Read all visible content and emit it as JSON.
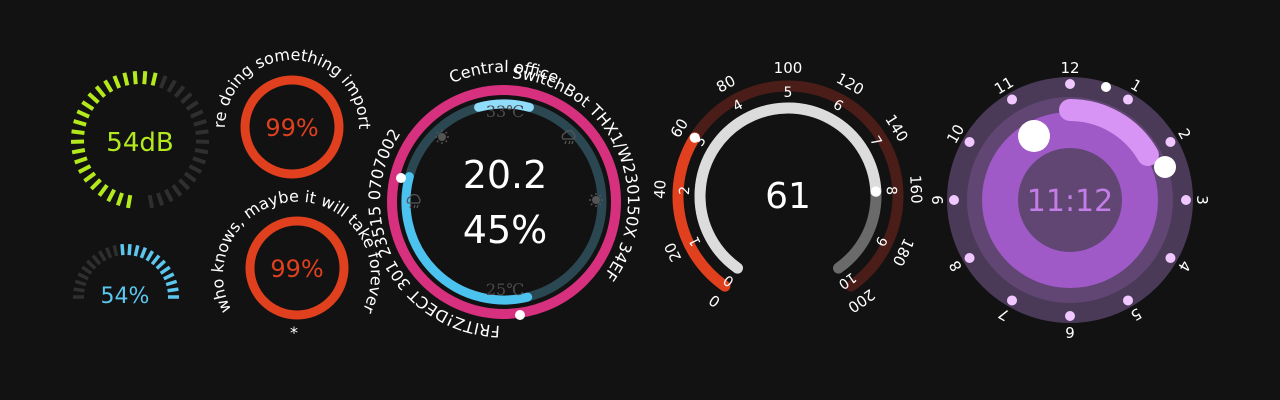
{
  "sound_gauge": {
    "value_text": "54dB",
    "level": 0.54,
    "color": "#b4ea1c"
  },
  "percent_gauge": {
    "value_text": "54%",
    "level": 0.54,
    "color": "#5cc6ee"
  },
  "ring_top": {
    "value_text": "99%",
    "caption": "we're doing something important",
    "level": 0.99,
    "color": "#e0401e"
  },
  "ring_bottom": {
    "value_text": "99%",
    "caption": "who knows, maybe it will take forever",
    "footnote": "*",
    "level": 0.99,
    "color": "#e0401e"
  },
  "thermostat": {
    "title": "Central office",
    "right_caption": "SwitchBot THX1/W230150X 34EF",
    "left_caption": "FRITZ!DECT 301 23515 0707002",
    "temperature": "20.2",
    "humidity": "45%",
    "top_limit": "33℃",
    "bottom_limit": "25℃",
    "icons": [
      "sun-icon",
      "cloud-icon",
      "sun-icon",
      "rain-icon"
    ],
    "colors": {
      "outer": "#d6307e",
      "inner": "#4cc2ee",
      "track": "#2a4752"
    }
  },
  "speedometer": {
    "value_text": "61",
    "outer_ticks": [
      "0",
      "20",
      "40",
      "60",
      "80",
      "100",
      "120",
      "140",
      "160",
      "180",
      "200"
    ],
    "inner_ticks": [
      "0",
      "1",
      "2",
      "3",
      "4",
      "5",
      "6",
      "7",
      "8",
      "9",
      "10"
    ],
    "outer_value": 60,
    "outer_max": 200,
    "inner_value": 8,
    "inner_max": 10,
    "colors": {
      "outer_fill": "#e0401e",
      "outer_track": "#4b1d18",
      "inner_fill": "#dcdcdc",
      "inner_track": "#6a6a6a"
    }
  },
  "clock": {
    "time_text": "11:12",
    "hour_labels": [
      "12",
      "1",
      "2",
      "3",
      "4",
      "5",
      "6",
      "7",
      "8",
      "9",
      "10",
      "11"
    ],
    "colors": {
      "face": "#5a3f6c",
      "ring": "#a05ac8",
      "accent": "#d894f4",
      "text": "#c27ee6"
    }
  }
}
